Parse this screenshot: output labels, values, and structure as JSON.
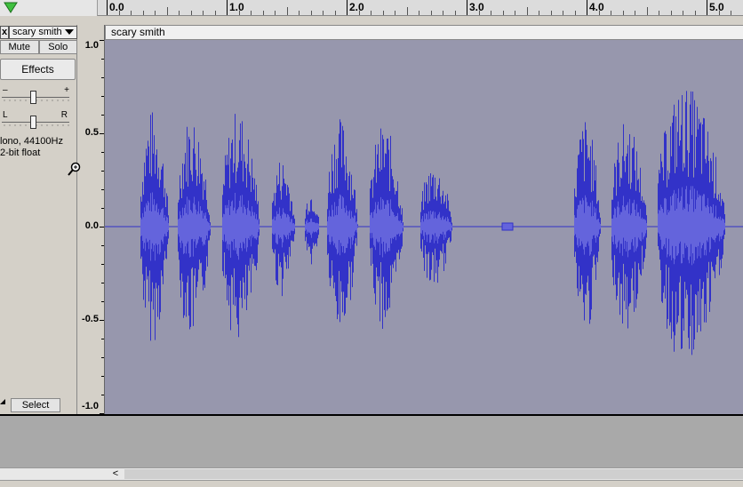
{
  "ruler": {
    "ticks": [
      {
        "label": "0.0",
        "sec": 0
      },
      {
        "label": "1.0",
        "sec": 1
      },
      {
        "label": "2.0",
        "sec": 2
      },
      {
        "label": "3.0",
        "sec": 3
      },
      {
        "label": "4.0",
        "sec": 4
      },
      {
        "label": "5.0",
        "sec": 5
      }
    ]
  },
  "track": {
    "close_label": "x",
    "name": "scary smith",
    "mute_label": "Mute",
    "solo_label": "Solo",
    "effects_label": "Effects",
    "gain_minus": "–",
    "gain_plus": "+",
    "pan_left": "L",
    "pan_right": "R",
    "format_line1": "lono, 44100Hz",
    "format_line2": "2-bit float",
    "select_label": "Select",
    "header_title": "scary smith"
  },
  "vscale": {
    "labels": [
      "1.0",
      "0.5",
      "0.0",
      "-0.5",
      "-1.0"
    ]
  },
  "colors": {
    "waveform": "#3232c8",
    "waveform_light": "#6464dc",
    "background": "#9797ad"
  },
  "scrollbar": {
    "left_arrow": "<"
  }
}
